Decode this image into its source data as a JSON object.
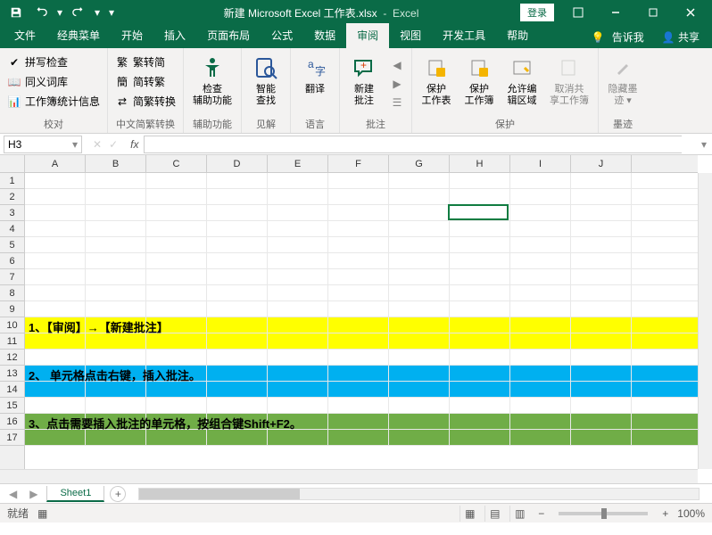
{
  "titlebar": {
    "filename": "新建 Microsoft Excel 工作表.xlsx",
    "app": "Excel",
    "login": "登录"
  },
  "tabs": {
    "items": [
      "文件",
      "经典菜单",
      "开始",
      "插入",
      "页面布局",
      "公式",
      "数据",
      "审阅",
      "视图",
      "开发工具",
      "帮助"
    ],
    "active": 7,
    "tellme": "告诉我",
    "share": "共享"
  },
  "ribbon": {
    "proofing": {
      "label": "校对",
      "spell": "拼写检查",
      "thesaurus": "同义词库",
      "stats": "工作簿统计信息"
    },
    "chinese": {
      "label": "中文简繁转换",
      "t2s": "繁转简",
      "s2t": "简转繁",
      "conv": "简繁转换"
    },
    "accessibility": {
      "label": "辅助功能",
      "check": "检查\n辅助功能"
    },
    "insights": {
      "label": "见解",
      "lookup": "智能\n查找"
    },
    "language": {
      "label": "语言",
      "translate": "翻译"
    },
    "comments": {
      "label": "批注",
      "new": "新建\n批注"
    },
    "protect": {
      "label": "保护",
      "sheet": "保护\n工作表",
      "book": "保护\n工作簿",
      "ranges": "允许编\n辑区域",
      "unshare": "取消共\n享工作簿"
    },
    "ink": {
      "label": "墨迹",
      "hide": "隐藏墨\n迹 ▾"
    }
  },
  "namebox": "H3",
  "columns": [
    "A",
    "B",
    "C",
    "D",
    "E",
    "F",
    "G",
    "H",
    "I",
    "J"
  ],
  "rows": [
    "1",
    "2",
    "3",
    "4",
    "5",
    "6",
    "7",
    "8",
    "9",
    "10",
    "11",
    "12",
    "13",
    "14",
    "15",
    "16",
    "17"
  ],
  "content": {
    "r10": "1、【审阅】→【新建批注】",
    "r13": "2、 单元格点击右键，插入批注。",
    "r16": "3、点击需要插入批注的单元格，按组合键Shift+F2。"
  },
  "sheet_tabs": {
    "active": "Sheet1"
  },
  "statusbar": {
    "ready": "就绪",
    "acc": "",
    "zoom": "100%"
  }
}
